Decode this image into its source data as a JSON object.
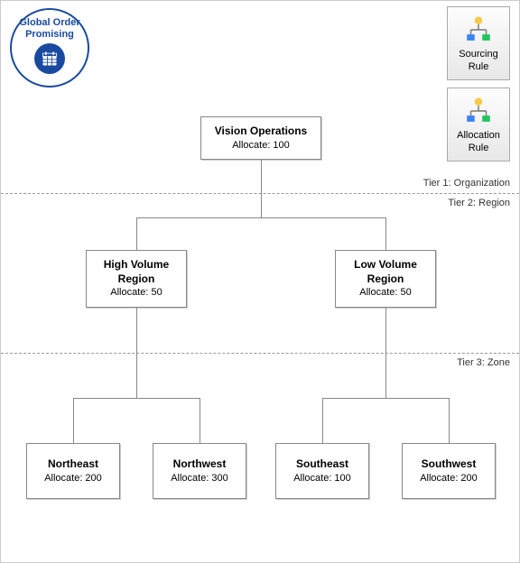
{
  "badge": {
    "line1": "Global Order",
    "line2": "Promising"
  },
  "buttons": {
    "sourcing": {
      "line1": "Sourcing",
      "line2": "Rule"
    },
    "allocation": {
      "line1": "Allocation",
      "line2": "Rule"
    }
  },
  "tiers": {
    "t1": "Tier 1: Organization",
    "t2": "Tier 2: Region",
    "t3": "Tier 3: Zone"
  },
  "nodes": {
    "root": {
      "title": "Vision Operations",
      "alloc": "Allocate: 100"
    },
    "hv": {
      "title1": "High Volume",
      "title2": "Region",
      "alloc": "Allocate: 50"
    },
    "lv": {
      "title1": "Low Volume",
      "title2": "Region",
      "alloc": "Allocate: 50"
    },
    "ne": {
      "title": "Northeast",
      "alloc": "Allocate: 200"
    },
    "nw": {
      "title": "Northwest",
      "alloc": "Allocate: 300"
    },
    "se": {
      "title": "Southeast",
      "alloc": "Allocate: 100"
    },
    "sw": {
      "title": "Southwest",
      "alloc": "Allocate: 200"
    }
  }
}
